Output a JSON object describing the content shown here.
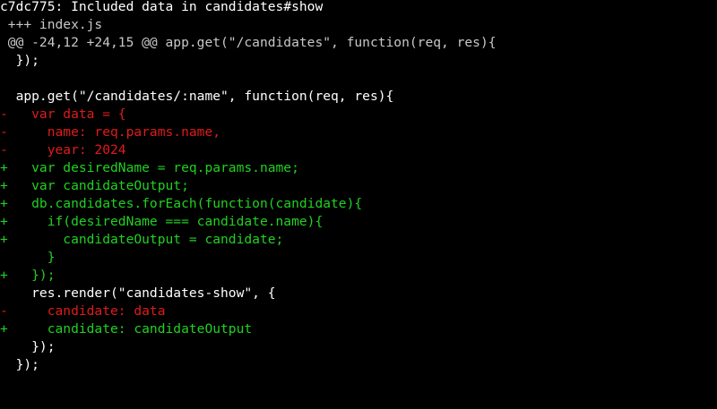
{
  "terminal": {
    "commit_header": "c7dc775: Included data in candidates#show",
    "diff_file": " +++ index.js",
    "hunk_header": " @@ -24,12 +24,15 @@ app.get(\"/candidates\", function(req, res){",
    "lines": [
      {
        "type": "context",
        "text": "  });"
      },
      {
        "type": "context",
        "text": ""
      },
      {
        "type": "context",
        "text": "  app.get(\"/candidates/:name\", function(req, res){"
      },
      {
        "type": "removed",
        "text": "-   var data = {"
      },
      {
        "type": "removed",
        "text": "-     name: req.params.name,"
      },
      {
        "type": "removed",
        "text": "-     year: 2024"
      },
      {
        "type": "added",
        "text": "+   var desiredName = req.params.name;"
      },
      {
        "type": "added",
        "text": "+   var candidateOutput;"
      },
      {
        "type": "added",
        "text": "+   db.candidates.forEach(function(candidate){"
      },
      {
        "type": "added",
        "text": "+     if(desiredName === candidate.name){"
      },
      {
        "type": "added",
        "text": "+       candidateOutput = candidate;"
      },
      {
        "type": "added",
        "text": "      }"
      },
      {
        "type": "added",
        "text": "+   });"
      },
      {
        "type": "context",
        "text": "    res.render(\"candidates-show\", {"
      },
      {
        "type": "removed",
        "text": "-     candidate: data"
      },
      {
        "type": "added",
        "text": "+     candidate: candidateOutput"
      },
      {
        "type": "context",
        "text": "    });"
      },
      {
        "type": "context",
        "text": "  });"
      }
    ]
  },
  "colors": {
    "background": "#000000",
    "text": "#ffffff",
    "meta": "#c8c8c8",
    "removed": "#e01b1b",
    "added": "#21d121"
  }
}
